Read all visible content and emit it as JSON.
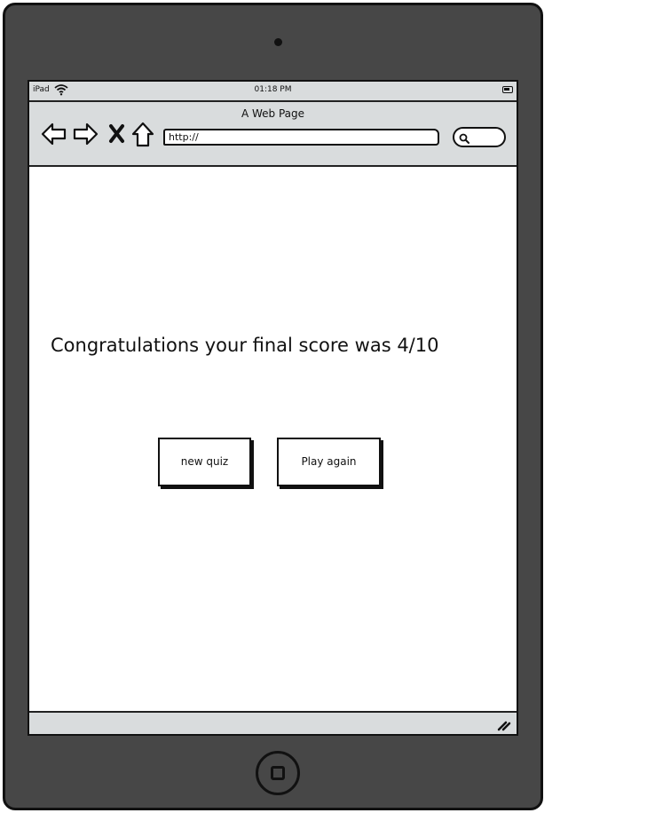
{
  "status_bar": {
    "device": "iPad",
    "time": "01:18 PM"
  },
  "browser": {
    "page_title": "A Web Page",
    "url": "http://",
    "nav_icons": [
      "back-arrow-icon",
      "forward-arrow-icon",
      "close-icon",
      "home-icon"
    ]
  },
  "content": {
    "message": "Congratulations your final  score was 4/10",
    "buttons": {
      "new_quiz": "new quiz",
      "play_again": "Play again"
    }
  },
  "colors": {
    "device_frame": "#474747",
    "chrome_gray": "#d9dcdd",
    "ink": "#111111"
  }
}
